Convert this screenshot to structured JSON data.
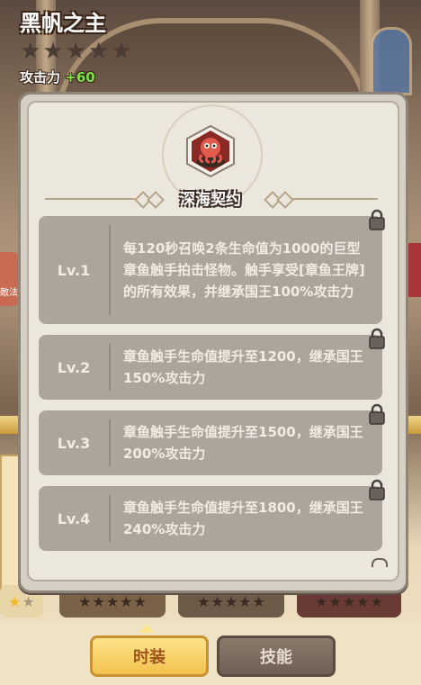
{
  "hero": {
    "name": "黑帆之主",
    "stars_filled": 0,
    "stars_total": 5,
    "attack_label": "攻击力",
    "attack_bonus": "+60"
  },
  "skill": {
    "title": "深海契约",
    "icon": "octopus-icon",
    "levels": [
      {
        "label": "Lv.1",
        "desc": "每120秒召唤2条生命值为1000的巨型章鱼触手拍击怪物。触手享受[章鱼王牌]的所有效果，并继承国王100%攻击力",
        "locked": true
      },
      {
        "label": "Lv.2",
        "desc": "章鱼触手生命值提升至1200，继承国王150%攻击力",
        "locked": true
      },
      {
        "label": "Lv.3",
        "desc": "章鱼触手生命值提升至1500，继承国王200%攻击力",
        "locked": true
      },
      {
        "label": "Lv.4",
        "desc": "章鱼触手生命值提升至1800，继承国王240%攻击力",
        "locked": true
      }
    ]
  },
  "side_left_text": "敵法",
  "tabs": {
    "fashion": "时装",
    "skill": "技能"
  },
  "colors": {
    "accent_gold": "#f2c24e",
    "attack_green": "#7ee04a",
    "panel": "#ece7dd",
    "level_row": "#aba59c"
  }
}
